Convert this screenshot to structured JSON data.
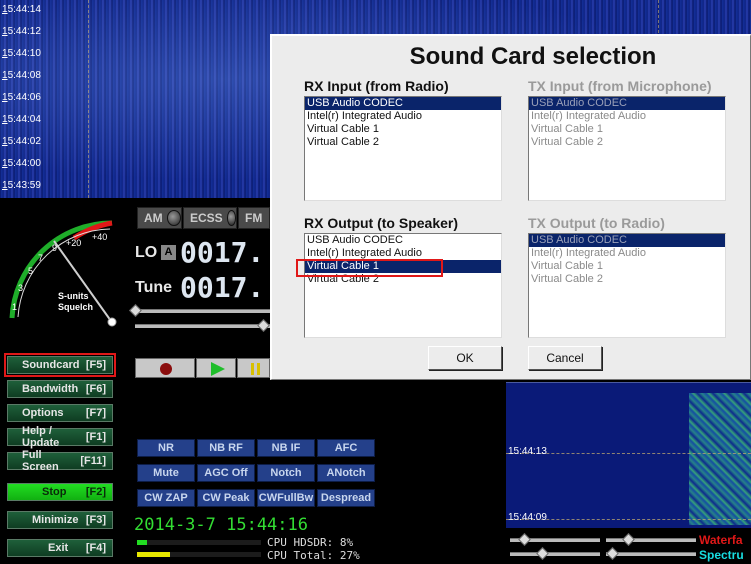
{
  "waterfall": {
    "times": [
      "15:44:14",
      "15:44:12",
      "15:44:10",
      "15:44:08",
      "15:44:06",
      "15:44:04",
      "15:44:02",
      "15:44:00",
      "15:43:59"
    ]
  },
  "smeter": {
    "scale": [
      "1",
      "3",
      "5",
      "7",
      "9",
      "+20",
      "+40"
    ],
    "label_line1": "S-units",
    "label_line2": "Squelch"
  },
  "modes": [
    {
      "label": "AM"
    },
    {
      "label": "ECSS"
    },
    {
      "label": "FM"
    }
  ],
  "frequency": {
    "lo_label": "LO",
    "vfo_label": "A",
    "lo_value": "0017.",
    "tune_label": "Tune",
    "tune_value": "0017."
  },
  "side_buttons": [
    {
      "label": "Soundcard",
      "key": "[F5]"
    },
    {
      "label": "Bandwidth",
      "key": "[F6]"
    },
    {
      "label": "Options",
      "key": "[F7]"
    },
    {
      "label": "Help / Update",
      "key": "[F1]"
    },
    {
      "label": "Full Screen",
      "key": "[F11]"
    },
    {
      "label": "Stop",
      "key": "[F2]"
    },
    {
      "label": "Minimize",
      "key": "[F3]"
    },
    {
      "label": "Exit",
      "key": "[F4]"
    }
  ],
  "dsp_buttons": [
    [
      "NR",
      "NB RF",
      "NB IF",
      "AFC"
    ],
    [
      "Mute",
      "AGC Off",
      "Notch",
      "ANotch"
    ],
    [
      "CW ZAP",
      "CW Peak",
      "CWFullBw",
      "Despread"
    ]
  ],
  "status": {
    "datetime": "2014-3-7 15:44:16",
    "cpu_hdsdr": "CPU HDSDR:  8%",
    "cpu_total": "CPU Total: 27%",
    "cpu_hdsdr_percent": 8,
    "cpu_total_percent": 27
  },
  "waterfall_right": {
    "times": [
      "15:44:13",
      "15:44:09"
    ],
    "legend_waterfall": "Waterfa",
    "legend_spectrum": "Spectru"
  },
  "dialog": {
    "title": "Sound Card selection",
    "rx_input": {
      "label": "RX Input (from Radio)",
      "items": [
        "USB Audio CODEC",
        "Intel(r) Integrated Audio",
        "Virtual Cable 1",
        "Virtual Cable 2"
      ],
      "selected": "USB Audio CODEC"
    },
    "tx_input": {
      "label": "TX Input (from Microphone)",
      "items": [
        "USB Audio CODEC",
        "Intel(r) Integrated Audio",
        "Virtual Cable 1",
        "Virtual Cable 2"
      ],
      "selected": "USB Audio CODEC"
    },
    "rx_output": {
      "label": "RX Output (to Speaker)",
      "items": [
        "USB Audio CODEC",
        "Intel(r) Integrated Audio",
        "Virtual Cable 1",
        "Virtual Cable 2"
      ],
      "selected": "Virtual Cable 1"
    },
    "tx_output": {
      "label": "TX Output (to Radio)",
      "items": [
        "USB Audio CODEC",
        "Intel(r) Integrated Audio",
        "Virtual Cable 1",
        "Virtual Cable 2"
      ],
      "selected": "USB Audio CODEC"
    },
    "ok_label": "OK",
    "cancel_label": "Cancel"
  },
  "colors": {
    "accent_red": "#e01818",
    "selection_blue": "#0a246a",
    "button_green": "#1f5f3a",
    "dsp_blue": "#24408a"
  }
}
